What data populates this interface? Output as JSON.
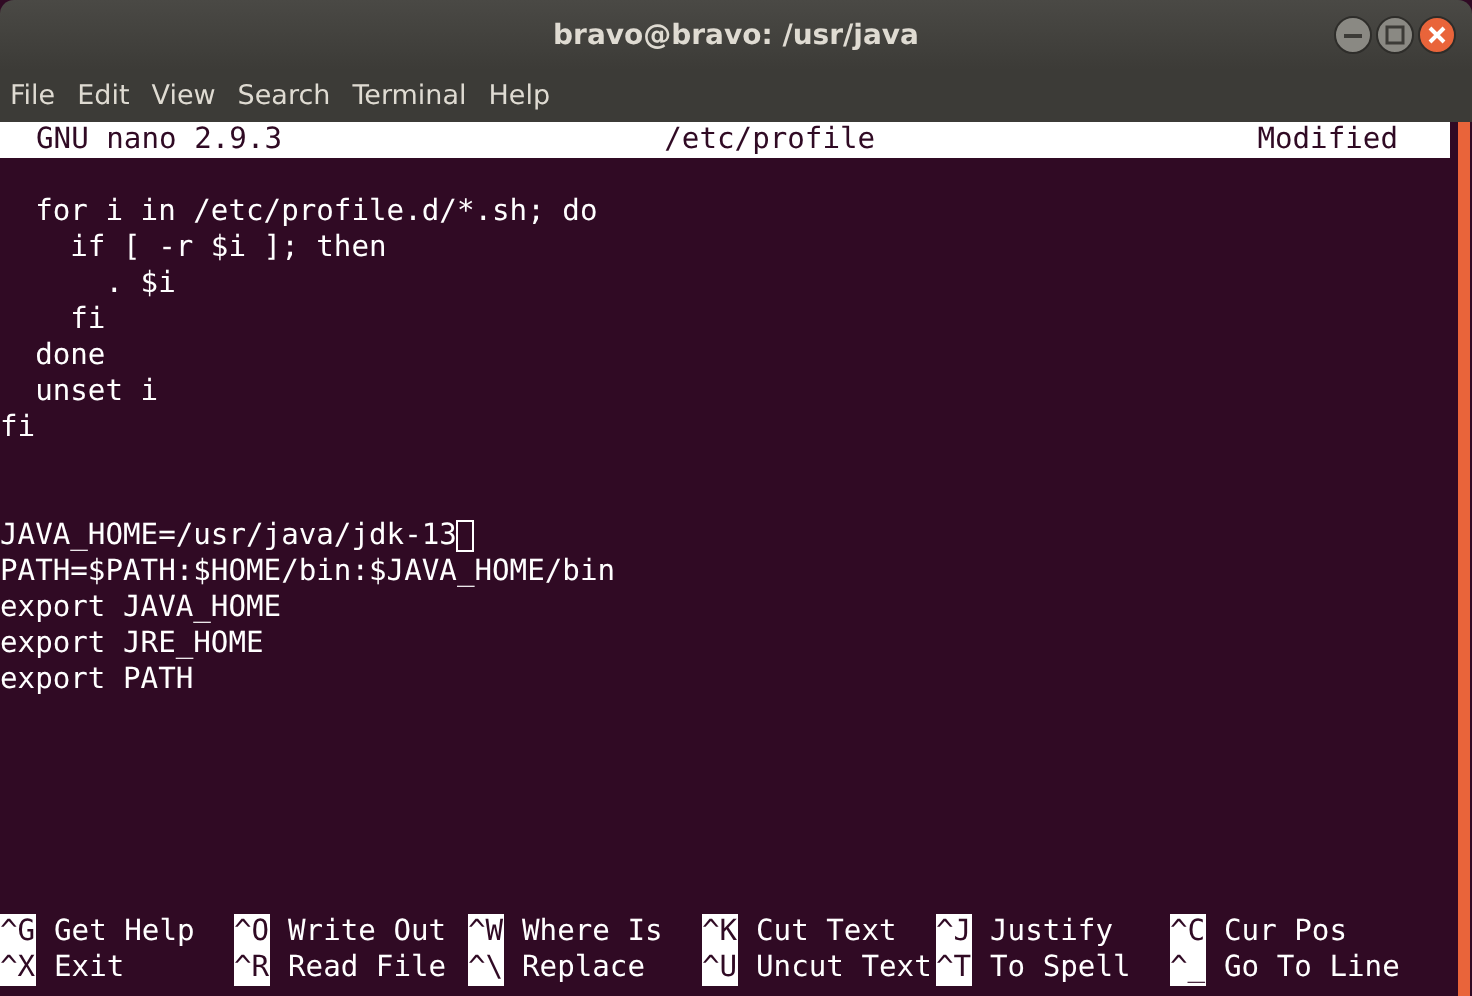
{
  "window": {
    "title": "bravo@bravo: /usr/java"
  },
  "menu": [
    "File",
    "Edit",
    "View",
    "Search",
    "Terminal",
    "Help"
  ],
  "nano_header": {
    "version": "GNU nano 2.9.3",
    "file": "/etc/profile",
    "status": "Modified"
  },
  "lines": [
    {
      "kind": "blank"
    },
    {
      "kind": "text",
      "text": "  for i in /etc/profile.d/*.sh; do"
    },
    {
      "kind": "text",
      "text": "    if [ -r $i ]; then"
    },
    {
      "kind": "text",
      "text": "      . $i"
    },
    {
      "kind": "text",
      "text": "    fi"
    },
    {
      "kind": "text",
      "text": "  done"
    },
    {
      "kind": "text",
      "text": "  unset i"
    },
    {
      "kind": "text",
      "text": "fi"
    },
    {
      "kind": "blank"
    },
    {
      "kind": "blank"
    },
    {
      "kind": "text",
      "text": "JAVA_HOME=/usr/java/jdk-13",
      "cursor": true
    },
    {
      "kind": "text",
      "text": "PATH=$PATH:$HOME/bin:$JAVA_HOME/bin"
    },
    {
      "kind": "text",
      "text": "export JAVA_HOME"
    },
    {
      "kind": "text",
      "text": "export JRE_HOME"
    },
    {
      "kind": "text",
      "text": "export PATH"
    }
  ],
  "shortcuts": [
    {
      "key": "^G",
      "label": "Get Help"
    },
    {
      "key": "^O",
      "label": "Write Out"
    },
    {
      "key": "^W",
      "label": "Where Is"
    },
    {
      "key": "^K",
      "label": "Cut Text"
    },
    {
      "key": "^J",
      "label": "Justify"
    },
    {
      "key": "^C",
      "label": "Cur Pos"
    },
    {
      "key": "^X",
      "label": "Exit"
    },
    {
      "key": "^R",
      "label": "Read File"
    },
    {
      "key": "^\\",
      "label": "Replace"
    },
    {
      "key": "^U",
      "label": "Uncut Text"
    },
    {
      "key": "^T",
      "label": "To Spell"
    },
    {
      "key": "^_",
      "label": "Go To Line"
    }
  ]
}
